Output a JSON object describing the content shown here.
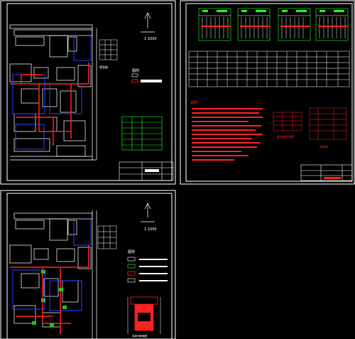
{
  "viewer": {
    "background": "#000000",
    "sheet_frame_color": "#ffffff",
    "line_colors": {
      "road": "#ffffff",
      "building": "#ffffff",
      "pipe_main": "#ff2020",
      "pipe_branch": "#2020ff",
      "legend_table": "#20ff20",
      "notes_text": "#ff2020",
      "node": "#20c020"
    }
  },
  "sheets": [
    {
      "id": "sheet-1",
      "north_label": "1:1000",
      "legend_title": "图例",
      "site_label": "规划图"
    },
    {
      "id": "sheet-2",
      "table_title_a": "配电箱系统图",
      "table_title_b": "材料表",
      "notes_header": "说明："
    },
    {
      "id": "sheet-3",
      "north_label": "1:1000",
      "legend_title": "图例",
      "detail_label": "电缆沟断面图"
    }
  ]
}
